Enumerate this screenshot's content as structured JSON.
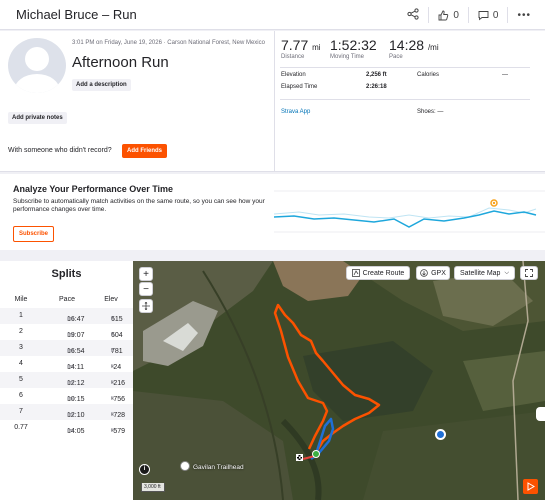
{
  "header": {
    "title": "Michael Bruce – Run",
    "kudos_count": "0",
    "comments_count": "0"
  },
  "activity": {
    "datetime_location": "3:01 PM on Friday, June 19, 2026 · Carson National Forest, New Mexico",
    "name": "Afternoon Run",
    "add_description": "Add a description",
    "add_private_notes": "Add private notes",
    "with_someone": "With someone who didn't record?",
    "add_friends": "Add Friends"
  },
  "stats": {
    "distance": {
      "value": "7.77",
      "unit": "mi",
      "label": "Distance"
    },
    "moving_time": {
      "value": "1:52:32",
      "label": "Moving Time"
    },
    "pace": {
      "value": "14:28",
      "unit": "/mi",
      "label": "Pace"
    },
    "elevation_label": "Elevation",
    "elevation_value": "2,256 ft",
    "calories_label": "Calories",
    "calories_value": "—",
    "elapsed_label": "Elapsed Time",
    "elapsed_value": "2:26:18",
    "device": "Strava App",
    "shoes_label": "Shoes:",
    "shoes_value": "—"
  },
  "analyze": {
    "title": "Analyze Your Performance Over Time",
    "description": "Subscribe to automatically match activities on the same route, so you can see how your performance changes over time.",
    "subscribe": "Subscribe"
  },
  "splits": {
    "title": "Splits",
    "headers": [
      "Mile",
      "Pace",
      "Elev"
    ],
    "pace_unit": "/mi",
    "elev_unit": "ft",
    "rows": [
      {
        "mile": "1",
        "pace": "16:47",
        "elev": "615"
      },
      {
        "mile": "2",
        "pace": "19:07",
        "elev": "604"
      },
      {
        "mile": "3",
        "pace": "16:54",
        "elev": "781"
      },
      {
        "mile": "4",
        "pace": "14:11",
        "elev": "-24"
      },
      {
        "mile": "5",
        "pace": "12:12",
        "elev": "-216"
      },
      {
        "mile": "6",
        "pace": "10:15",
        "elev": "-756"
      },
      {
        "mile": "7",
        "pace": "12:10",
        "elev": "-728"
      },
      {
        "mile": "0.77",
        "pace": "14:05",
        "elev": "-579"
      }
    ]
  },
  "map": {
    "zoom_in": "+",
    "zoom_out": "−",
    "create_route": "Create Route",
    "gpx": "GPX",
    "map_type": "Satellite Map",
    "trailhead": "Gavilan Trailhead",
    "scale": "3,000 ft"
  },
  "colors": {
    "brand": "#fc5200",
    "link": "#0073b7",
    "route_up": "#fc5200",
    "route_down": "#1f6fd6",
    "trend_line": "#1ea7dc"
  }
}
